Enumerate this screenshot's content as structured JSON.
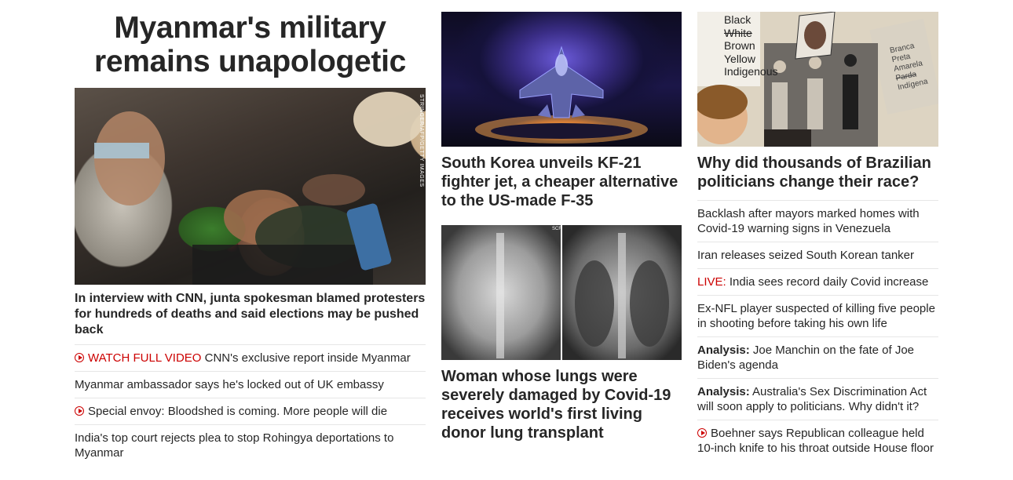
{
  "col1": {
    "hero_title": "Myanmar's military remains unapologetic",
    "image_credit": "STRINGER/AFP/GETTY IMAGES",
    "lead_text": "In interview with CNN, junta spokesman blamed protesters for hundreds of deaths and said elections may be pushed back",
    "items": [
      {
        "prefix": "WATCH FULL VIDEO",
        "text": " CNN's exclusive report inside Myanmar",
        "icon": "play-icon"
      },
      {
        "prefix": "",
        "text": "Myanmar ambassador says he's locked out of UK embassy",
        "icon": ""
      },
      {
        "prefix": "",
        "text": "Special envoy: Bloodshed is coming. More people will die",
        "icon": "play-icon"
      },
      {
        "prefix": "",
        "text": "India's top court rejects plea to stop Rohingya deportations to Myanmar",
        "icon": ""
      }
    ]
  },
  "col2": {
    "story1_headline": "South Korea unveils KF-21 fighter jet, a cheaper alternative to the US-made F-35",
    "story2_headline": "Woman whose lungs were severely damaged by Covid-19 receives world's first living donor lung transplant",
    "xray_marker": "SCR"
  },
  "col3": {
    "headline": "Why did thousands of Brazilian politicians change their race?",
    "collage_words_left": [
      "Black",
      "White",
      "Brown",
      "Yellow",
      "Indigenous"
    ],
    "collage_words_right": [
      "Branca",
      "Preta",
      "Amarela",
      "Parda",
      "Indígena"
    ],
    "items": [
      {
        "label": "",
        "text": "Backlash after mayors marked homes with Covid-19 warning signs in Venezuela",
        "icon": ""
      },
      {
        "label": "",
        "text": "Iran releases seized South Korean tanker",
        "icon": ""
      },
      {
        "label": "LIVE:",
        "text": " India sees record daily Covid increase",
        "icon": "",
        "label_style": "red"
      },
      {
        "label": "",
        "text": "Ex-NFL player suspected of killing five people in shooting before taking his own life",
        "icon": ""
      },
      {
        "label": "Analysis:",
        "text": " Joe Manchin on the fate of Joe Biden's agenda",
        "icon": "",
        "label_style": "bold"
      },
      {
        "label": "Analysis:",
        "text": " Australia's Sex Discrimination Act will soon apply to politicians. Why didn't it?",
        "icon": "",
        "label_style": "bold"
      },
      {
        "label": "",
        "text": "Boehner says Republican colleague held 10-inch knife to his throat outside House floor",
        "icon": "play-icon"
      }
    ]
  },
  "colors": {
    "accent_red": "#cc0000",
    "text": "#262626",
    "divider": "#e6e6e6"
  }
}
